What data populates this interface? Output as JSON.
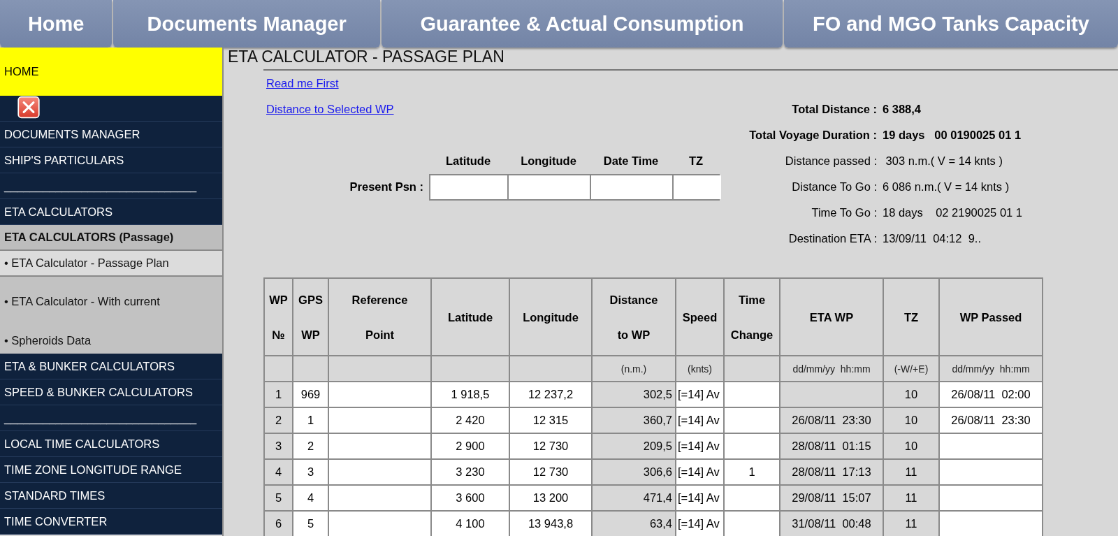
{
  "tabs": [
    {
      "label": "Home"
    },
    {
      "label": "Documents Manager"
    },
    {
      "label": "Guarantee & Actual Consumption"
    },
    {
      "label": "FO and MGO Tanks Capacity"
    }
  ],
  "page_title": "ETA CALCULATOR - PASSAGE PLAN",
  "sidebar": [
    {
      "kind": "highlight",
      "label": "HOME"
    },
    {
      "kind": "spacer"
    },
    {
      "kind": "nav",
      "label": "DOCUMENTS MANAGER"
    },
    {
      "kind": "nav",
      "label": "SHIP'S PARTICULARS"
    },
    {
      "kind": "divider",
      "label": "______________________________"
    },
    {
      "kind": "nav",
      "label": "ETA CALCULATORS"
    },
    {
      "kind": "section",
      "label": "ETA CALCULATORS  (Passage)"
    },
    {
      "kind": "current",
      "label": "• ETA Calculator - Passage Plan"
    },
    {
      "kind": "sub",
      "label": "• ETA Calculator - With current"
    },
    {
      "kind": "sub",
      "label": "• Spheroids Data"
    },
    {
      "kind": "nav",
      "label": "ETA & BUNKER CALCULATORS"
    },
    {
      "kind": "nav",
      "label": "SPEED & BUNKER CALCULATORS"
    },
    {
      "kind": "divider",
      "label": "______________________________"
    },
    {
      "kind": "nav",
      "label": "LOCAL TIME CALCULATORS"
    },
    {
      "kind": "nav",
      "label": "TIME ZONE LONGITUDE RANGE"
    },
    {
      "kind": "nav",
      "label": "STANDARD TIMES"
    },
    {
      "kind": "nav",
      "label": "TIME CONVERTER"
    }
  ],
  "links": [
    "Read me First",
    "Distance to Selected WP"
  ],
  "present_position": {
    "label": "Present Psn :",
    "fields": [
      "Latitude",
      "Longitude",
      "Date Time",
      "TZ"
    ]
  },
  "summary": [
    {
      "label": "Total Distance :",
      "value": "6 388,4",
      "bold": true
    },
    {
      "label": "Total Voyage Duration :",
      "value": "19 days   00 0190025 01 1",
      "bold": true
    },
    {
      "label": "Distance passed :",
      "value": " 303 n.m.( V = 14 knts )",
      "bold": false
    },
    {
      "label": "Distance To Go :",
      "value": "6 086 n.m.( V = 14 knts )",
      "bold": false
    },
    {
      "label": "Time To Go :",
      "value": "18 days    02 2190025 01 1",
      "bold": false
    },
    {
      "label": "Destination ETA :",
      "value": "13/09/11  04:12  9..",
      "bold": false
    }
  ],
  "table": {
    "columns": [
      {
        "heading": [
          "WP",
          "№"
        ],
        "kind": "calc"
      },
      {
        "heading": [
          "GPS",
          "WP"
        ],
        "kind": "input"
      },
      {
        "heading": [
          "Reference",
          "Point"
        ],
        "kind": "input"
      },
      {
        "heading": [
          "Latitude"
        ],
        "kind": "input"
      },
      {
        "heading": [
          "Longitude"
        ],
        "kind": "input"
      },
      {
        "heading": [
          "Distance",
          "to WP"
        ],
        "unit": "(n.m.)",
        "kind": "calc"
      },
      {
        "heading": [
          "Speed"
        ],
        "unit": "(knts)",
        "kind": "input"
      },
      {
        "heading": [
          "Time",
          "Change"
        ],
        "kind": "input"
      },
      {
        "heading": [
          "ETA  WP"
        ],
        "unit": "dd/mm/yy  hh:mm",
        "kind": "calc"
      },
      {
        "heading": [
          "TZ"
        ],
        "unit": "(-W/+E)",
        "kind": "calc"
      },
      {
        "heading": [
          "WP Passed"
        ],
        "unit": "dd/mm/yy  hh:mm",
        "kind": "input"
      }
    ],
    "rows": [
      [
        "1",
        "969",
        null,
        "1 918,5",
        "12 237,2",
        "302,5",
        "[=14] Av",
        null,
        null,
        "10",
        "26/08/11  02:00"
      ],
      [
        "2",
        "1",
        null,
        "2 420",
        "12 315",
        "360,7",
        "[=14] Av",
        null,
        "26/08/11  23:30",
        "10",
        "26/08/11  23:30"
      ],
      [
        "3",
        "2",
        null,
        "2 900",
        "12 730",
        "209,5",
        "[=14] Av",
        null,
        "28/08/11  01:15",
        "10",
        null
      ],
      [
        "4",
        "3",
        null,
        "3 230",
        "12 730",
        "306,6",
        "[=14] Av",
        "1",
        "28/08/11  17:13",
        "11",
        null
      ],
      [
        "5",
        "4",
        null,
        "3 600",
        "13 200",
        "471,4",
        "[=14] Av",
        null,
        "29/08/11  15:07",
        "11",
        null
      ],
      [
        "6",
        "5",
        null,
        "4 100",
        "13 943,8",
        "63,4",
        "[=14] Av",
        null,
        "31/08/11  00:48",
        "11",
        null
      ]
    ]
  }
}
